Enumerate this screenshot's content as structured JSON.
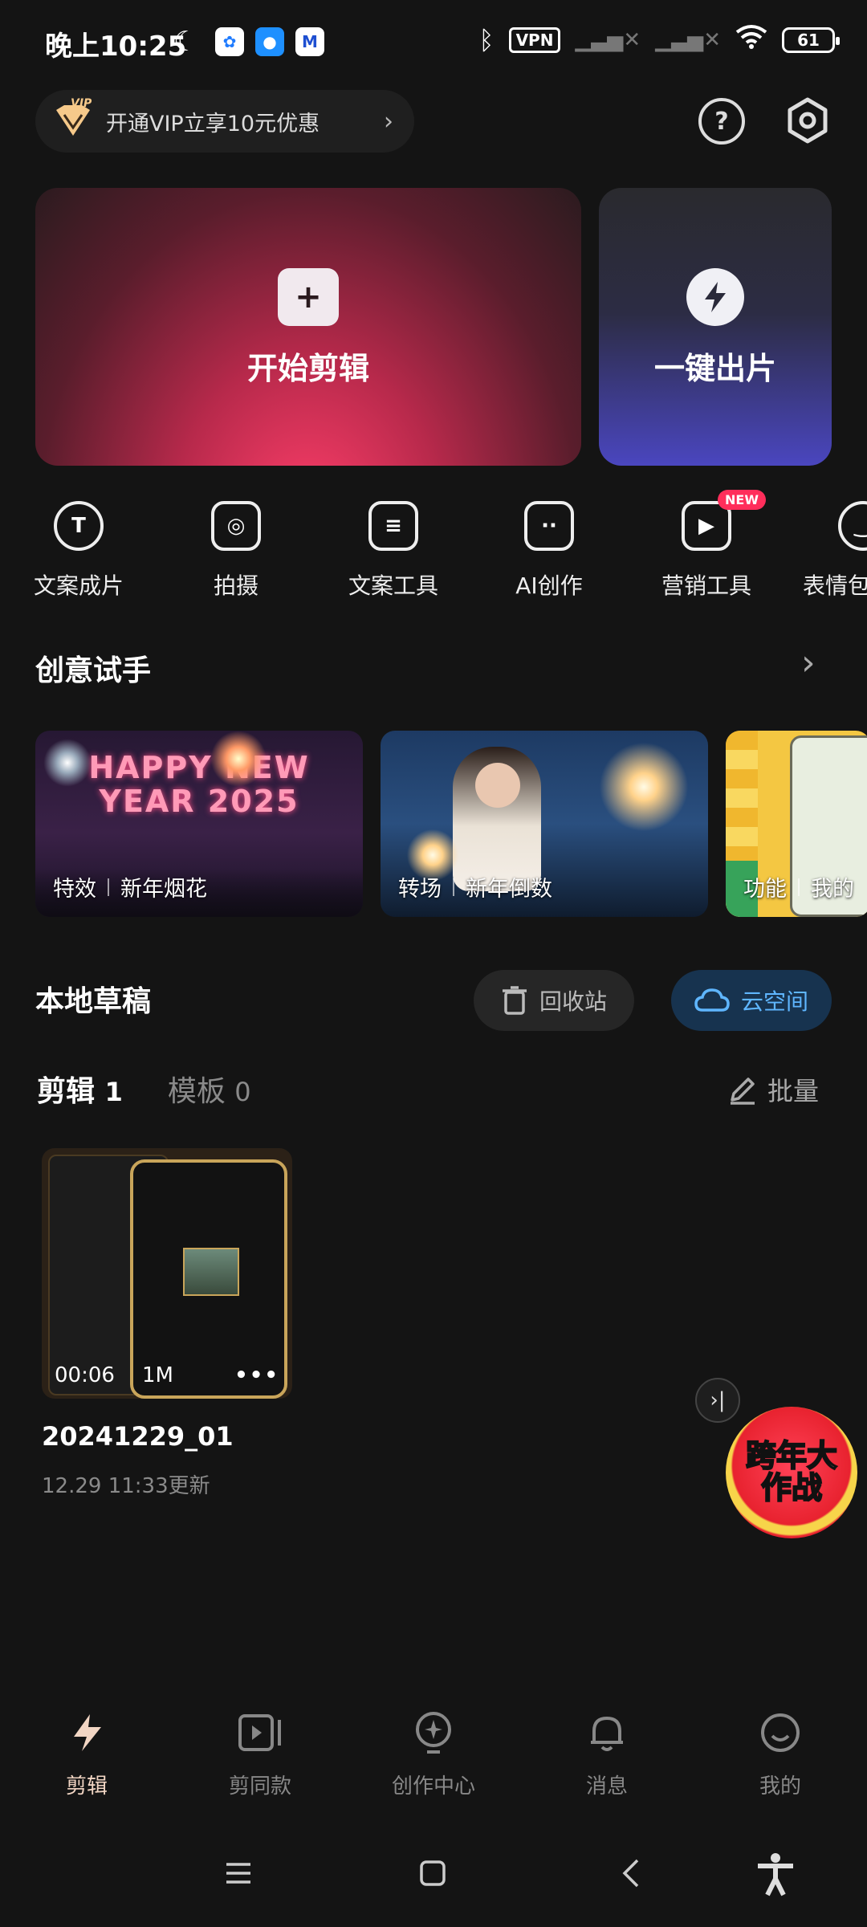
{
  "status_bar": {
    "time": "晚上10:25",
    "vpn": "VPN",
    "battery": "61"
  },
  "vip_banner": {
    "label": "开通VIP立享10元优惠",
    "badge": "VIP"
  },
  "main_cards": {
    "start_edit": "开始剪辑",
    "one_click": "一键出片"
  },
  "tools": [
    {
      "label": "文案成片",
      "icon": "text-ai-icon"
    },
    {
      "label": "拍摄",
      "icon": "camera-icon"
    },
    {
      "label": "文案工具",
      "icon": "doc-sparkle-icon"
    },
    {
      "label": "AI创作",
      "icon": "robot-icon"
    },
    {
      "label": "营销工具",
      "icon": "play-sparkle-icon",
      "badge": "NEW"
    },
    {
      "label": "表情包",
      "icon": "smile-icon"
    }
  ],
  "creative": {
    "title": "创意试手",
    "items": [
      {
        "tag": "特效",
        "name": "新年烟花",
        "overlay": "HAPPY NEW YEAR 2025"
      },
      {
        "tag": "转场",
        "name": "新年倒数"
      },
      {
        "tag": "功能",
        "name": "我的"
      }
    ]
  },
  "drafts": {
    "title": "本地草稿",
    "recycle": "回收站",
    "cloud": "云空间",
    "tab_edit": "剪辑",
    "tab_edit_count": "1",
    "tab_template": "模板",
    "tab_template_count": "0",
    "batch": "批量",
    "items": [
      {
        "duration": "00:06",
        "size": "1M",
        "name": "20241229_01",
        "updated": "12.29 11:33更新"
      }
    ]
  },
  "promo": {
    "text": "跨年大作战"
  },
  "bottom_nav": [
    {
      "label": "剪辑",
      "active": true
    },
    {
      "label": "剪同款"
    },
    {
      "label": "创作中心"
    },
    {
      "label": "消息"
    },
    {
      "label": "我的"
    }
  ],
  "colors": {
    "background": "#141414",
    "accent_pink": "#ff3f6a",
    "accent_blue": "#4a46bf",
    "cloud_blue": "#3fa8ff"
  }
}
